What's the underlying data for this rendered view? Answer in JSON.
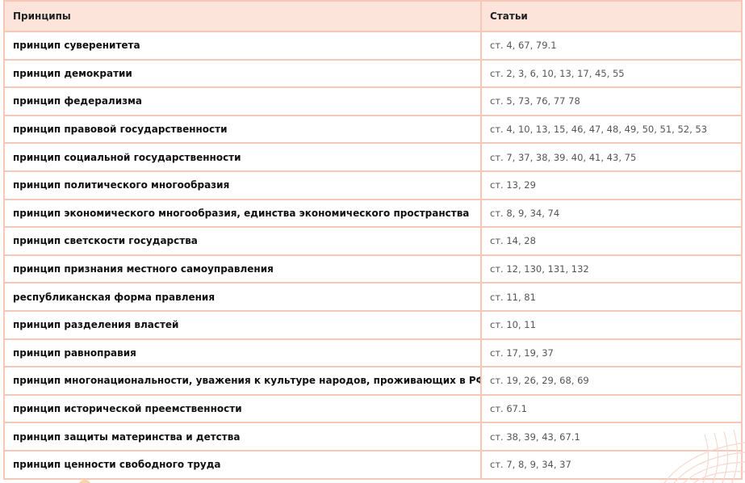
{
  "table": {
    "headers": {
      "principle": "Принципы",
      "articles": "Статьи"
    },
    "rows": [
      {
        "principle": "принцип суверенитета",
        "articles": "ст. 4, 67, 79.1"
      },
      {
        "principle": "принцип демократии",
        "articles": "ст. 2, 3, 6, 10, 13, 17, 45, 55"
      },
      {
        "principle": "принцип федерализма",
        "articles": "ст. 5, 73, 76, 77 78"
      },
      {
        "principle": "принцип правовой государственности",
        "articles": "ст. 4, 10, 13, 15, 46, 47, 48, 49, 50, 51, 52, 53"
      },
      {
        "principle": "принцип социальной государственности",
        "articles": "ст. 7, 37, 38, 39. 40, 41, 43, 75"
      },
      {
        "principle": "принцип политического многообразия",
        "articles": "ст. 13, 29"
      },
      {
        "principle": "принцип экономического многообразия, единства экономического пространства",
        "articles": "ст. 8, 9, 34, 74"
      },
      {
        "principle": "принцип светскости государства",
        "articles": "ст. 14, 28"
      },
      {
        "principle": "принцип признания местного самоуправления",
        "articles": "ст. 12, 130, 131, 132"
      },
      {
        "principle": "республиканская форма правления",
        "articles": "ст. 11, 81"
      },
      {
        "principle": "принцип разделения властей",
        "articles": "ст. 10, 11"
      },
      {
        "principle": "принцип равноправия",
        "articles": "ст. 17, 19, 37"
      },
      {
        "principle": "принцип многонациональности, уважения к культуре народов, проживающих в РФ",
        "articles": "ст. 19, 26, 29, 68, 69"
      },
      {
        "principle": "принцип исторической преемственности",
        "articles": "ст. 67.1"
      },
      {
        "principle": "принцип защиты материнства и детства",
        "articles": "ст. 38, 39, 43, 67.1"
      },
      {
        "principle": "принцип ценности свободного труда",
        "articles": "ст. 7, 8, 9, 34, 37"
      }
    ]
  },
  "colors": {
    "header_bg": "#fce4da",
    "border": "#f6c6b6"
  }
}
